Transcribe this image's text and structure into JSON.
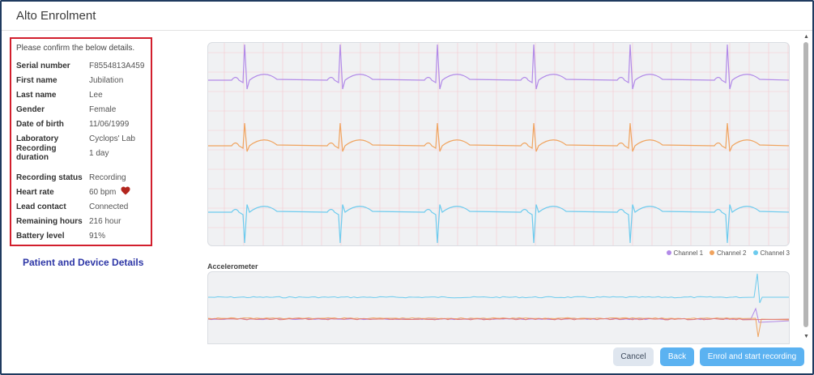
{
  "window": {
    "title": "Alto Enrolment"
  },
  "details": {
    "intro": "Please confirm the below details.",
    "rows_a": [
      {
        "label": "Serial number",
        "value": "F8554813A459"
      },
      {
        "label": "First name",
        "value": "Jubilation"
      },
      {
        "label": "Last name",
        "value": "Lee"
      },
      {
        "label": "Gender",
        "value": "Female"
      },
      {
        "label": "Date of birth",
        "value": "11/06/1999"
      },
      {
        "label": "Laboratory",
        "value": "Cyclops' Lab"
      },
      {
        "label": "Recording duration",
        "value": "1 day"
      }
    ],
    "rows_b": [
      {
        "label": "Recording status",
        "value": "Recording"
      },
      {
        "label": "Heart rate",
        "value": "60 bpm"
      },
      {
        "label": "Lead contact",
        "value": "Connected"
      },
      {
        "label": "Remaining hours",
        "value": "216 hour"
      },
      {
        "label": "Battery level",
        "value": "91%"
      }
    ],
    "heart_icon": "heart-icon",
    "heart_color": "#b3261e"
  },
  "caption": "Patient and Device Details",
  "ecg": {
    "channels": [
      {
        "name": "Channel 1",
        "color": "#b28ae8"
      },
      {
        "name": "Channel 2",
        "color": "#f0a35e"
      },
      {
        "name": "Channel 3",
        "color": "#6ccbee"
      }
    ]
  },
  "accelerometer": {
    "label": "Accelerometer",
    "colors": [
      "#6ccbee",
      "#e07b7b",
      "#f0a35e",
      "#b28ae8"
    ]
  },
  "buttons": {
    "cancel": "Cancel",
    "back": "Back",
    "enrol": "Enrol and start recording"
  },
  "scroll_icons": {
    "up": "triangle-up-icon",
    "down": "triangle-down-icon"
  }
}
